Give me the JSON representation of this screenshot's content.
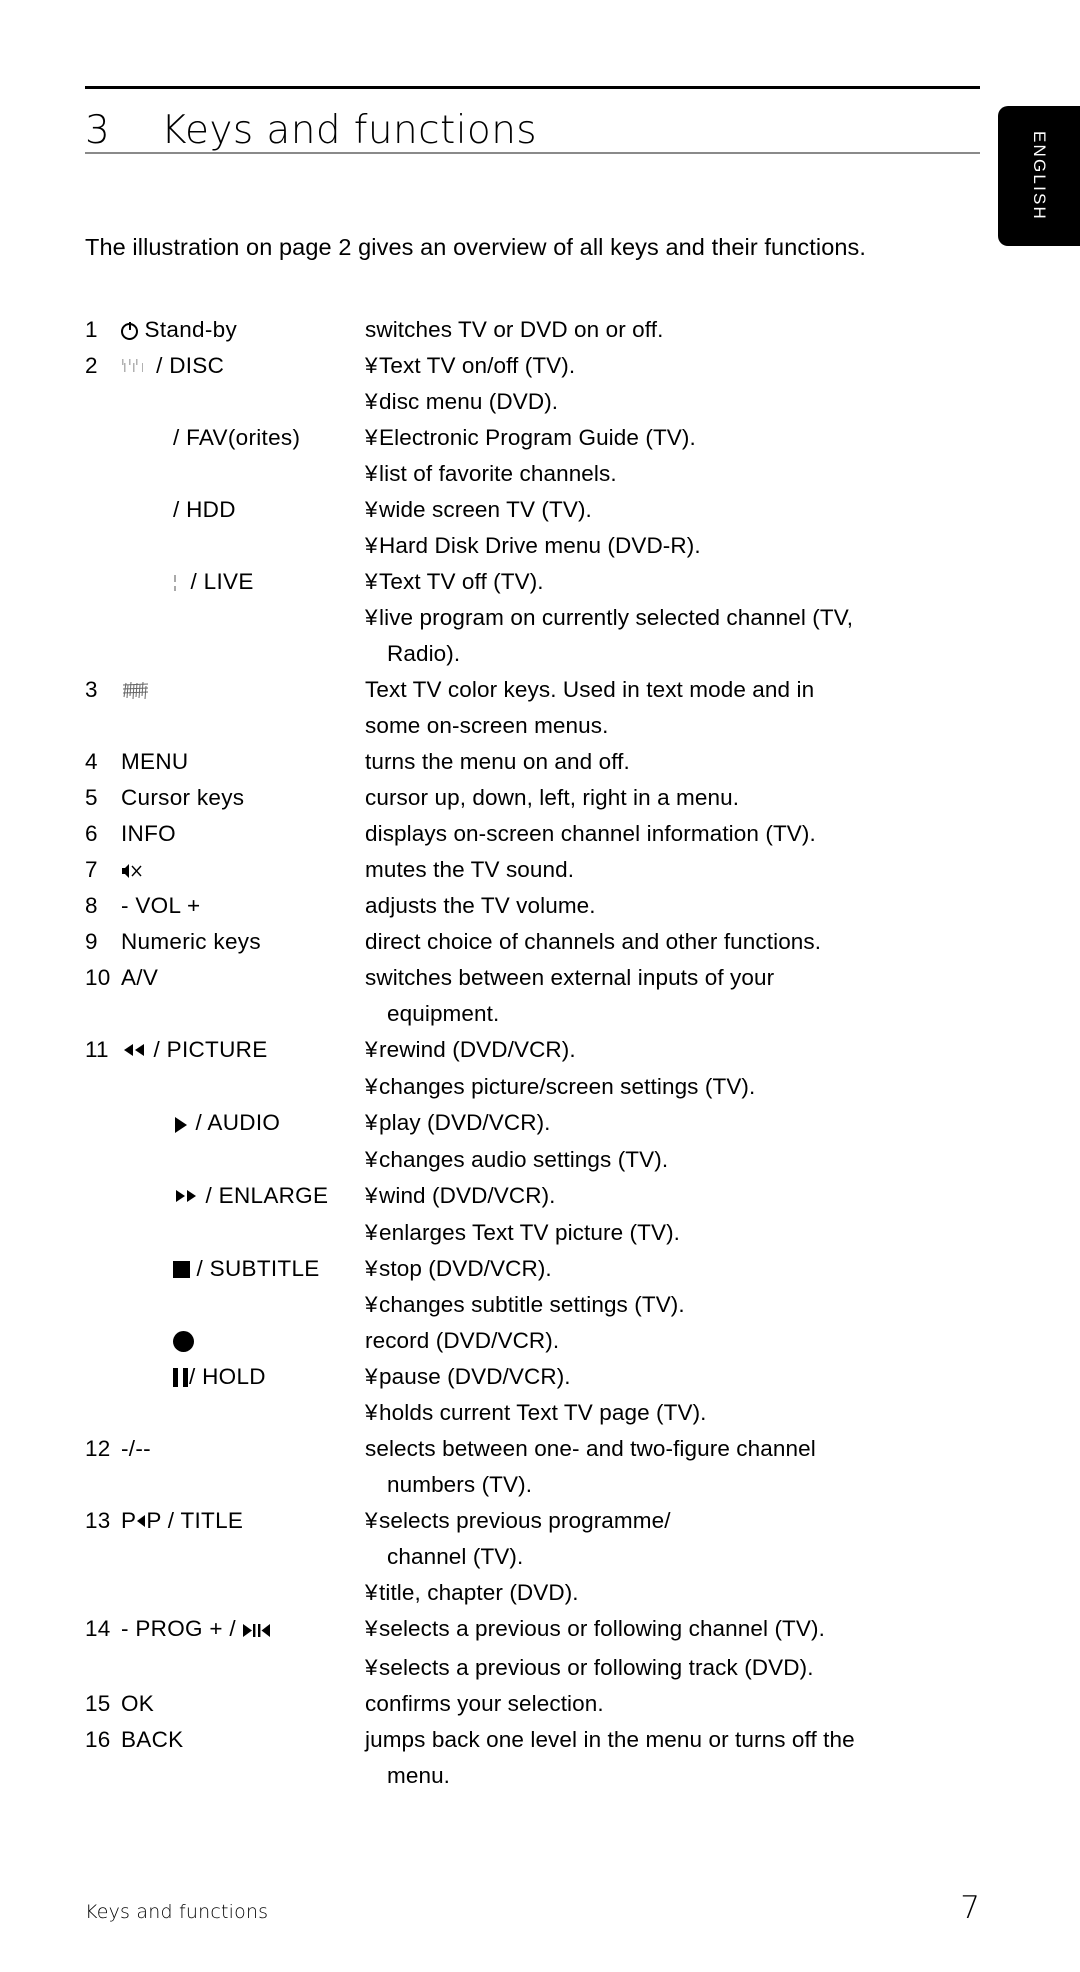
{
  "language_tab": {
    "label": "ENGLISH"
  },
  "header": {
    "chapter_number": "3",
    "chapter_title": "Keys and functions"
  },
  "intro": "The illustration on page 2 gives an overview of all keys and their functions.",
  "bullet_char": "¥",
  "keys": [
    {
      "index": "1",
      "label": "Stand-by",
      "icon": "power-icon",
      "lines": [
        {
          "bullet": "",
          "text": "switches TV or DVD on or off."
        }
      ]
    },
    {
      "index": "2",
      "label": "/ DISC",
      "icon": "teletext-faint-icon",
      "lines": [
        {
          "bullet": "¥",
          "text": "Text TV on/off (TV)."
        },
        {
          "bullet": "¥",
          "text": "disc menu (DVD)."
        }
      ]
    },
    {
      "index": "",
      "label": "/ FAV(orites)",
      "icon": "",
      "indent": true,
      "lines": [
        {
          "bullet": "¥",
          "text": "Electronic Program Guide (TV)."
        },
        {
          "bullet": "¥",
          "text": "list of favorite channels."
        }
      ]
    },
    {
      "index": "",
      "label": "/ HDD",
      "icon": "",
      "indent": true,
      "lines": [
        {
          "bullet": "¥",
          "text": "wide screen TV (TV)."
        },
        {
          "bullet": "¥",
          "text": "Hard Disk Drive menu (DVD-R)."
        }
      ]
    },
    {
      "index": "",
      "label": "/ LIVE",
      "icon": "teletext-faint2-icon",
      "indent": true,
      "lines": [
        {
          "bullet": "¥",
          "text": "Text TV off (TV)."
        },
        {
          "bullet": "¥",
          "text": "live program on currently selected channel (TV,"
        },
        {
          "bullet": "",
          "text": "Radio).",
          "cont": true
        }
      ]
    },
    {
      "index": "3",
      "label": "",
      "icon": "color-keys-icon",
      "lines": [
        {
          "bullet": "",
          "text": "Text TV color keys. Used in text mode and in"
        },
        {
          "bullet": "",
          "text": "some on-screen menus."
        }
      ]
    },
    {
      "index": "4",
      "label": "MENU",
      "icon": "",
      "lines": [
        {
          "bullet": "",
          "text": "turns the menu on and off."
        }
      ]
    },
    {
      "index": "5",
      "label": "Cursor keys",
      "icon": "",
      "lines": [
        {
          "bullet": "",
          "text": "cursor up, down, left, right in a menu."
        }
      ]
    },
    {
      "index": "6",
      "label": "INFO",
      "icon": "",
      "lines": [
        {
          "bullet": "",
          "text": "displays on-screen channel information (TV)."
        }
      ]
    },
    {
      "index": "7",
      "label": "",
      "icon": "mute-icon",
      "lines": [
        {
          "bullet": "",
          "text": "mutes the TV sound."
        }
      ]
    },
    {
      "index": "8",
      "label": "- VOL +",
      "icon": "",
      "lines": [
        {
          "bullet": "",
          "text": "adjusts the TV volume."
        }
      ]
    },
    {
      "index": "9",
      "label": "Numeric keys",
      "icon": "",
      "lines": [
        {
          "bullet": "",
          "text": "direct choice of channels and other functions."
        }
      ]
    },
    {
      "index": "10",
      "label": "A/V",
      "icon": "",
      "lines": [
        {
          "bullet": "",
          "text": "switches between external inputs of your"
        },
        {
          "bullet": "",
          "text": "equipment.",
          "cont": true
        }
      ]
    },
    {
      "index": "11",
      "label": "/ PICTURE",
      "icon": "rewind-icon",
      "lines": [
        {
          "bullet": "¥",
          "text": "rewind (DVD/VCR)."
        },
        {
          "bullet": "¥",
          "text": "changes picture/screen settings (TV)."
        }
      ]
    },
    {
      "index": "",
      "label": "/ AUDIO",
      "icon": "play-icon",
      "indent": true,
      "lines": [
        {
          "bullet": "¥",
          "text": "play (DVD/VCR)."
        },
        {
          "bullet": "¥",
          "text": "changes audio settings (TV)."
        }
      ]
    },
    {
      "index": "",
      "label": "/ ENLARGE",
      "icon": "fast-forward-icon",
      "indent": true,
      "lines": [
        {
          "bullet": "¥",
          "text": "wind (DVD/VCR)."
        },
        {
          "bullet": "¥",
          "text": "enlarges Text TV picture (TV)."
        }
      ]
    },
    {
      "index": "",
      "label": "/ SUBTITLE",
      "icon": "stop-icon",
      "indent": true,
      "lines": [
        {
          "bullet": "¥",
          "text": "stop (DVD/VCR)."
        },
        {
          "bullet": "¥",
          "text": "changes subtitle settings (TV)."
        }
      ]
    },
    {
      "index": "",
      "label": "",
      "icon": "record-icon",
      "indent": true,
      "lines": [
        {
          "bullet": "",
          "text": "record (DVD/VCR)."
        }
      ]
    },
    {
      "index": "",
      "label": "/ HOLD",
      "icon": "pause-icon",
      "indent": true,
      "lines": [
        {
          "bullet": "¥",
          "text": "pause (DVD/VCR)."
        },
        {
          "bullet": "¥",
          "text": "holds current Text TV page (TV)."
        }
      ]
    },
    {
      "index": "12",
      "label": "-/--",
      "icon": "",
      "lines": [
        {
          "bullet": "",
          "text": "selects between one- and two-figure channel"
        },
        {
          "bullet": "",
          "text": "numbers  (TV).",
          "cont": true
        }
      ]
    },
    {
      "index": "13",
      "label": "P   P / TITLE",
      "icon": "prev-prog-icon",
      "lines": [
        {
          "bullet": "¥",
          "text": "selects previous programme/"
        },
        {
          "bullet": "",
          "text": "channel (TV).",
          "cont": true
        },
        {
          "bullet": "¥",
          "text": "title, chapter (DVD)."
        }
      ]
    },
    {
      "index": "14",
      "label": "- PROG + /",
      "icon": "next-prev-track-icon",
      "lines": [
        {
          "bullet": "¥",
          "text": "selects a previous or following channel (TV)."
        },
        {
          "bullet": "¥",
          "text": "selects a previous or following track (DVD)."
        }
      ]
    },
    {
      "index": "15",
      "label": "OK",
      "icon": "",
      "lines": [
        {
          "bullet": "",
          "text": "confirms your selection."
        }
      ]
    },
    {
      "index": "16",
      "label": "BACK",
      "icon": "",
      "lines": [
        {
          "bullet": "",
          "text": "jumps back one level in the menu or turns off the"
        },
        {
          "bullet": "",
          "text": "menu.",
          "cont": true
        }
      ]
    }
  ],
  "footer": {
    "section": "Keys and functions",
    "page_number": "7"
  }
}
